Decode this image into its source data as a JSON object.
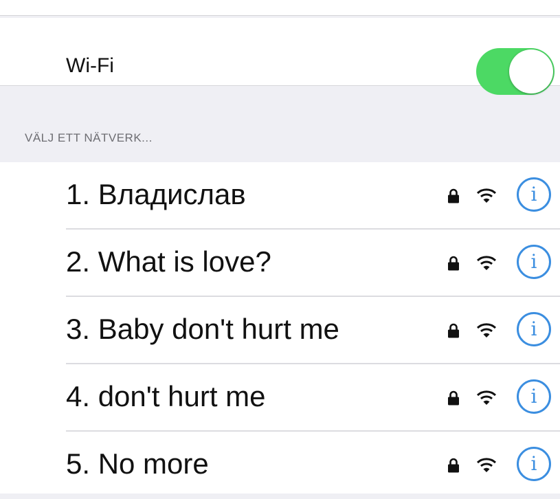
{
  "wifi": {
    "label": "Wi-Fi",
    "enabled": true,
    "toggle_color": "#4cd964"
  },
  "section_header": "VÄLJ ETT NÄTVERK...",
  "networks": [
    {
      "name": "1. Владислав",
      "secured": true,
      "icons": [
        "lock-icon",
        "wifi-signal-icon",
        "info-icon"
      ]
    },
    {
      "name": "2. What is love?",
      "secured": true,
      "icons": [
        "lock-icon",
        "wifi-signal-icon",
        "info-icon"
      ]
    },
    {
      "name": "3. Baby don't hurt me",
      "secured": true,
      "icons": [
        "lock-icon",
        "wifi-signal-icon",
        "info-icon"
      ]
    },
    {
      "name": "4. don't hurt me",
      "secured": true,
      "icons": [
        "lock-icon",
        "wifi-signal-icon",
        "info-icon"
      ]
    },
    {
      "name": "5. No more",
      "secured": true,
      "icons": [
        "lock-icon",
        "wifi-signal-icon",
        "info-icon"
      ]
    }
  ],
  "info_glyph": "i",
  "accent_color": "#3b8ee0"
}
